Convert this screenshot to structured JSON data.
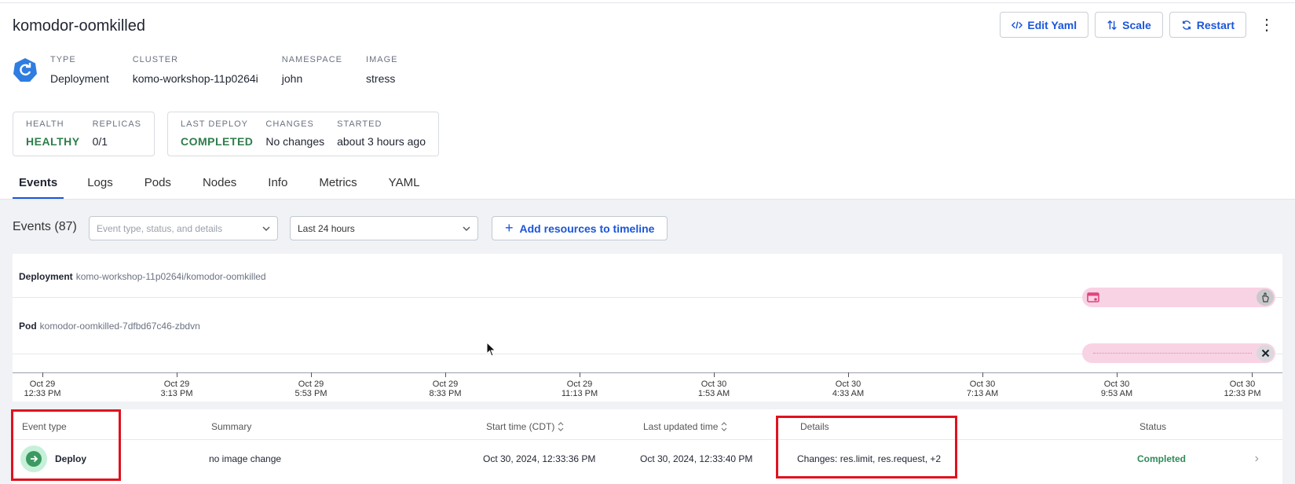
{
  "header": {
    "title": "komodor-oomkilled",
    "actions": {
      "edit_yaml": "Edit Yaml",
      "scale": "Scale",
      "restart": "Restart"
    }
  },
  "meta": {
    "type_label": "TYPE",
    "type_value": "Deployment",
    "cluster_label": "CLUSTER",
    "cluster_value": "komo-workshop-11p0264i",
    "namespace_label": "NAMESPACE",
    "namespace_value": "john",
    "image_label": "IMAGE",
    "image_value": "stress"
  },
  "cards": {
    "health_label": "HEALTH",
    "health_value": "HEALTHY",
    "replicas_label": "REPLICAS",
    "replicas_value": "0/1",
    "last_deploy_label": "LAST DEPLOY",
    "last_deploy_value": "COMPLETED",
    "changes_label": "CHANGES",
    "changes_value": "No changes",
    "started_label": "STARTED",
    "started_value": "about 3 hours ago"
  },
  "tabs": [
    "Events",
    "Logs",
    "Pods",
    "Nodes",
    "Info",
    "Metrics",
    "YAML"
  ],
  "events": {
    "title": "Events (87)",
    "filter_placeholder": "Event type, status, and details",
    "time_range": "Last 24 hours",
    "add_resources": "Add resources to timeline"
  },
  "timeline": {
    "rows": [
      {
        "kind": "Deployment",
        "name": "komo-workshop-11p0264i/komodor-oomkilled"
      },
      {
        "kind": "Pod",
        "name": "komodor-oomkilled-7dfbd67c46-zbdvn"
      }
    ],
    "ticks": [
      {
        "date": "Oct 29",
        "time": "12:33 PM"
      },
      {
        "date": "Oct 29",
        "time": "3:13 PM"
      },
      {
        "date": "Oct 29",
        "time": "5:53 PM"
      },
      {
        "date": "Oct 29",
        "time": "8:33 PM"
      },
      {
        "date": "Oct 29",
        "time": "11:13 PM"
      },
      {
        "date": "Oct 30",
        "time": "1:53 AM"
      },
      {
        "date": "Oct 30",
        "time": "4:33 AM"
      },
      {
        "date": "Oct 30",
        "time": "7:13 AM"
      },
      {
        "date": "Oct 30",
        "time": "9:53 AM"
      },
      {
        "date": "Oct 30",
        "time": "12:33 PM"
      }
    ]
  },
  "table": {
    "headers": {
      "event_type": "Event type",
      "summary": "Summary",
      "start_time": "Start time (CDT)",
      "last_updated": "Last updated time",
      "details": "Details",
      "status": "Status"
    },
    "row": {
      "event_type": "Deploy",
      "summary": "no image change",
      "start_time": "Oct 30, 2024, 12:33:36 PM",
      "last_updated": "Oct 30, 2024, 12:33:40 PM",
      "details": "Changes: res.limit, res.request, +2",
      "status": "Completed"
    }
  },
  "colors": {
    "accent": "#1b55d9",
    "healthy": "#2e7d4a",
    "highlight": "#e0121e",
    "timeline_bar": "#f8d3e4"
  }
}
